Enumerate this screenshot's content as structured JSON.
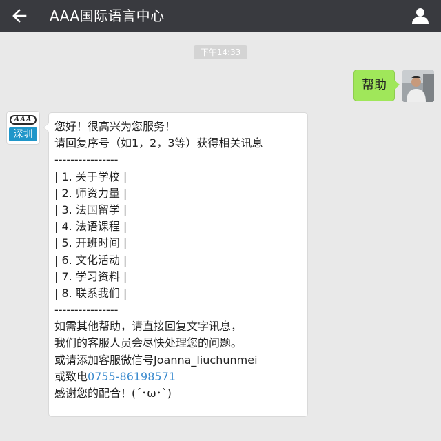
{
  "header": {
    "title": "AAA国际语言中心",
    "back_icon": "back-arrow-icon",
    "profile_icon": "person-icon"
  },
  "chat": {
    "timestamp": "下午14:33",
    "outgoing_message": "帮助",
    "bot_avatar": {
      "logo_text": "AAA",
      "city_text": "深圳"
    },
    "reply": {
      "greeting": "您好！很高兴为您服务！",
      "instruction": "请回复序号（如1，2，3等）获得相关讯息",
      "divider": "----------------",
      "menu": [
        "| 1. 关于学校 |",
        "| 2. 师资力量 |",
        "| 3. 法国留学 |",
        "| 4. 法语课程 |",
        "| 5. 开班时间 |",
        "| 6. 文化活动 |",
        "| 7. 学习资料 |",
        "| 8. 联系我们 |"
      ],
      "help_line_1": "如需其他帮助，请直接回复文字讯息，",
      "help_line_2": "我们的客服人员会尽快处理您的问题。",
      "wechat_line": "或请添加客服微信号Joanna_liuchunmei",
      "phone_prefix": "或致电",
      "phone_number": "0755-86198571",
      "thanks": "感谢您的配合！(´･ω･`)"
    }
  },
  "colors": {
    "header_bg": "#393a3f",
    "chat_bg": "#e9e9e9",
    "outgoing_bubble": "#a0e75a",
    "link": "#3d8ccf"
  }
}
